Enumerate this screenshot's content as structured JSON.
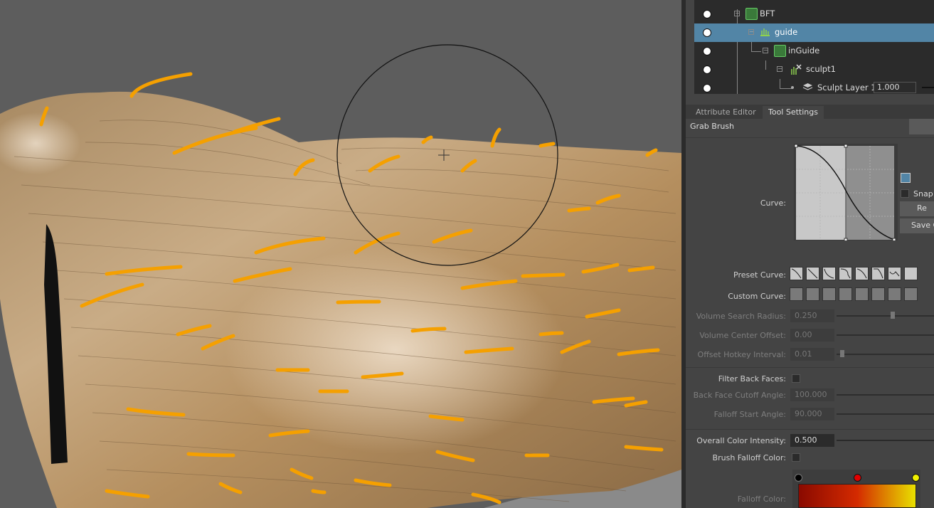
{
  "outliner": {
    "items": [
      {
        "label": "BFT",
        "icon": "node-icon",
        "selected": false
      },
      {
        "label": "guide",
        "icon": "hair-guide-icon",
        "selected": true
      },
      {
        "label": "inGuide",
        "icon": "node-icon",
        "selected": false
      },
      {
        "label": "sculpt1",
        "icon": "sculpt-node-icon",
        "selected": false
      },
      {
        "label": "Sculpt Layer 1",
        "icon": "layers-icon",
        "selected": false,
        "value": "1.000"
      }
    ]
  },
  "tabs": {
    "attribute_editor": "Attribute Editor",
    "tool_settings": "Tool Settings"
  },
  "tool": {
    "name": "Grab Brush",
    "curve_label": "Curve:",
    "snap_label": "Snap",
    "reset_label": "Re",
    "save_label": "Save C",
    "preset_curve_label": "Preset Curve:",
    "custom_curve_label": "Custom Curve:",
    "volume_search_radius": {
      "label": "Volume Search Radius:",
      "value": "0.250"
    },
    "volume_center_offset": {
      "label": "Volume Center Offset:",
      "value": "0.00"
    },
    "offset_hotkey_interval": {
      "label": "Offset Hotkey Interval:",
      "value": "0.01"
    },
    "filter_back_faces": {
      "label": "Filter Back Faces:"
    },
    "back_face_cutoff_angle": {
      "label": "Back Face Cutoff Angle:",
      "value": "100.000"
    },
    "falloff_start_angle": {
      "label": "Falloff Start Angle:",
      "value": "90.000"
    },
    "overall_color_intensity": {
      "label": "Overall Color Intensity:",
      "value": "0.500"
    },
    "brush_falloff_color": {
      "label": "Brush Falloff Color:"
    },
    "falloff_color": {
      "label": "Falloff Color:"
    }
  },
  "colors": {
    "selection": "#5285a6",
    "guide_orange": "#f5a000",
    "hair_tan": "#b8966a",
    "gradient_start": "#8a0a00",
    "gradient_mid": "#d42a00",
    "gradient_end": "#e8e000"
  }
}
